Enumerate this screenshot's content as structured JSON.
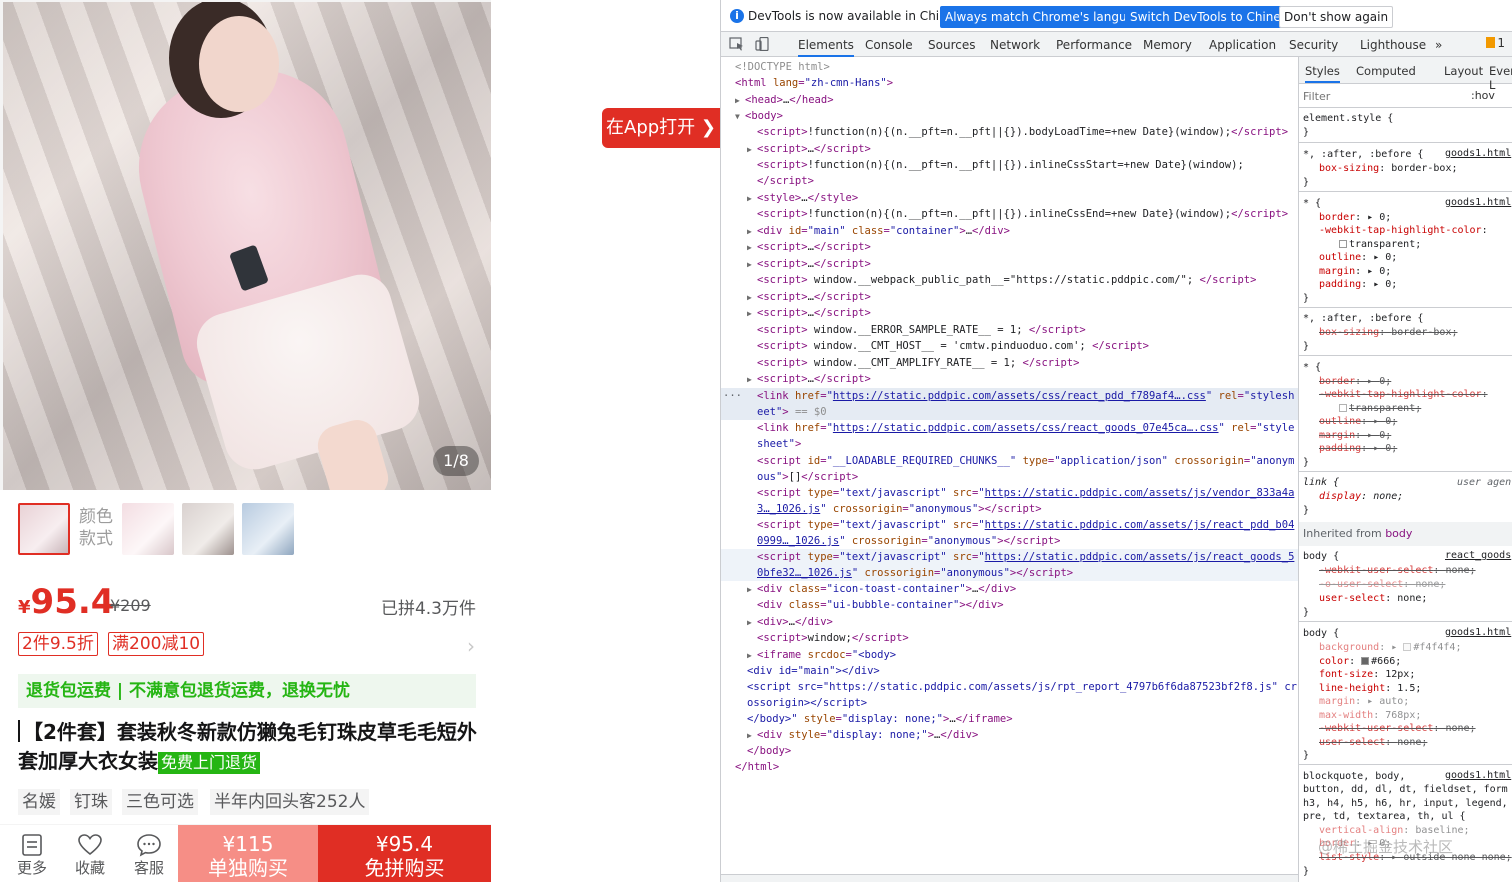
{
  "product": {
    "image_counter": "1/8",
    "color_label": "颜色款式",
    "price_symbol": "¥",
    "price": "95.4",
    "original_price": "¥209",
    "sold": "已拼4.3万件",
    "coupons": [
      "2件9.5折",
      "满200减10"
    ],
    "guarantee": "退货包运费 | 不满意包退货运费，退换无忧",
    "title": "【2件套】套装秋冬新款仿獭兔毛钉珠皮草毛毛短外套加厚大衣女装",
    "title_badge": "免费上门退货",
    "tags": [
      "名媛",
      "钉珠",
      "三色可选",
      "半年内回头客252人"
    ],
    "bottom_items": [
      "更多",
      "收藏",
      "客服"
    ],
    "buy_alone_price": "¥115",
    "buy_alone_label": "单独购买",
    "buy_group_price": "¥95.4",
    "buy_group_label": "免拼购买",
    "open_app": "在App打开 ❯"
  },
  "devtools": {
    "infobar": {
      "text": "DevTools is now available in Chinese!",
      "btn_match": "Always match Chrome's language",
      "btn_switch": "Switch DevTools to Chinese",
      "btn_dismiss": "Don't show again"
    },
    "tabs": [
      "Elements",
      "Console",
      "Sources",
      "Network",
      "Performance",
      "Memory",
      "Application",
      "Security",
      "Lighthouse",
      "»"
    ],
    "issues_count": "1",
    "styles_tabs": [
      "Styles",
      "Computed",
      "Layout",
      "Event L"
    ],
    "filter_placeholder": "Filter",
    "hov": ":hov",
    "inherited_label": "Inherited from",
    "inherited_from": "body",
    "watermark": "@稀土掘金技术社区"
  },
  "colors": {
    "accent": "#e02e24",
    "green": "#25b513",
    "devtools_blue": "#1a73e8"
  }
}
